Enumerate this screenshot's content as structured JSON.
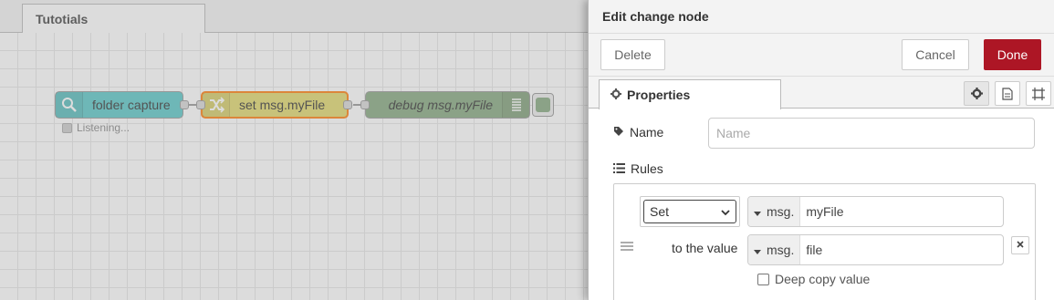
{
  "workspace": {
    "tab_label": "Tutotials",
    "nodes": {
      "watch": {
        "label": "folder capture",
        "status": "Listening..."
      },
      "change": {
        "label": "set msg.myFile"
      },
      "debug": {
        "label": "debug msg.myFile"
      }
    }
  },
  "tray": {
    "title": "Edit change node",
    "buttons": {
      "delete": "Delete",
      "cancel": "Cancel",
      "done": "Done"
    },
    "tab": "Properties",
    "name": {
      "label": "Name",
      "placeholder": "Name",
      "value": ""
    },
    "rules": {
      "label": "Rules",
      "action": "Set",
      "target": {
        "type": "msg.",
        "value": "myFile"
      },
      "to_label": "to the value",
      "source": {
        "type": "msg.",
        "value": "file"
      },
      "deep_copy_label": "Deep copy value",
      "deep_copy_checked": false
    }
  },
  "colors": {
    "done": "#ad1625",
    "watch_node": "#5cc8c8",
    "change_node": "#e2d96e",
    "debug_node": "#87a980",
    "selected_border": "#ff7f0e"
  },
  "icons": [
    "search-icon",
    "shuffle-icon",
    "list-icon",
    "gear-icon",
    "file-icon",
    "frame-icon",
    "tag-icon",
    "caret-down-icon",
    "close-icon",
    "drag-handle-icon"
  ]
}
